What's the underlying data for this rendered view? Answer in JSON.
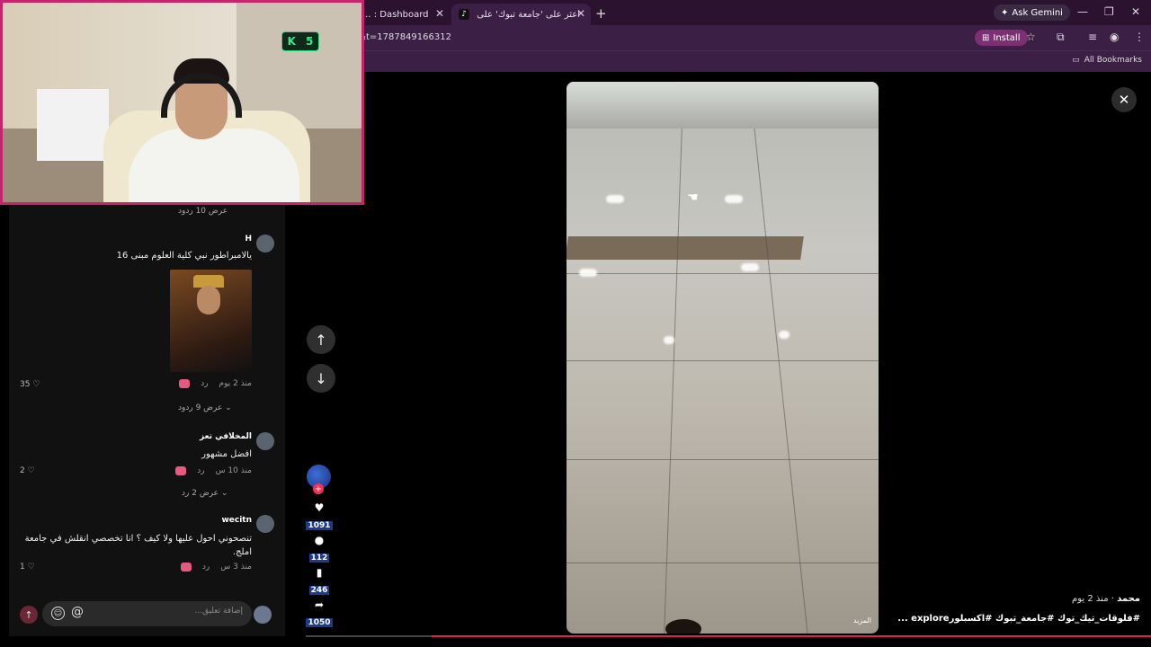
{
  "browser": {
    "tabs": [
      {
        "label": "... : Dashboard",
        "active": false
      },
      {
        "label": "اعثر على 'جامعة تبوك' على ...",
        "active": true
      }
    ],
    "new_tab": "+",
    "ask_gemini": "Ask Gemini",
    "url": "e&t=1787849166312",
    "install": "Install",
    "all_bookmarks": "All Bookmarks"
  },
  "webcam": {
    "counter_value": "5"
  },
  "comments": {
    "top_replies": "عرض 10 ردود",
    "items": [
      {
        "user": "H",
        "text": "يالامبراطور نبي كلية العلوم مبنى 16",
        "time": "منذ 2 يوم",
        "reply": "رد",
        "likes": "35",
        "view_replies": "عرض 9 ردود"
      },
      {
        "user": "المخلافي تعز",
        "text": "افضل مشهور",
        "time": "منذ 10 س",
        "reply": "رد",
        "likes": "2",
        "view_replies": "عرض 2 رد"
      },
      {
        "user": "wecitn",
        "text": "تنصحوني احول عليها ولا كيف ؟ انا تخصصي انقلش في جامعة املج.",
        "time": "منذ 3 س",
        "reply": "رد",
        "likes": "1"
      }
    ],
    "input_placeholder": "إضافة تعليق..."
  },
  "actions": {
    "likes": "1091",
    "comments": "112",
    "saves": "246",
    "shares": "1050"
  },
  "video": {
    "more_label": "المزيد",
    "author": "محمد",
    "time_ago": "منذ 2 يوم",
    "caption": "#فلوقات_تيك_توك #جامعة_تبوك #اكسبلورexplore ...",
    "progress": 0.06
  },
  "colors": {
    "accent": "#e0244f",
    "chrome_bg": "#3c1f44",
    "count_badge": "#1e3a8a"
  }
}
